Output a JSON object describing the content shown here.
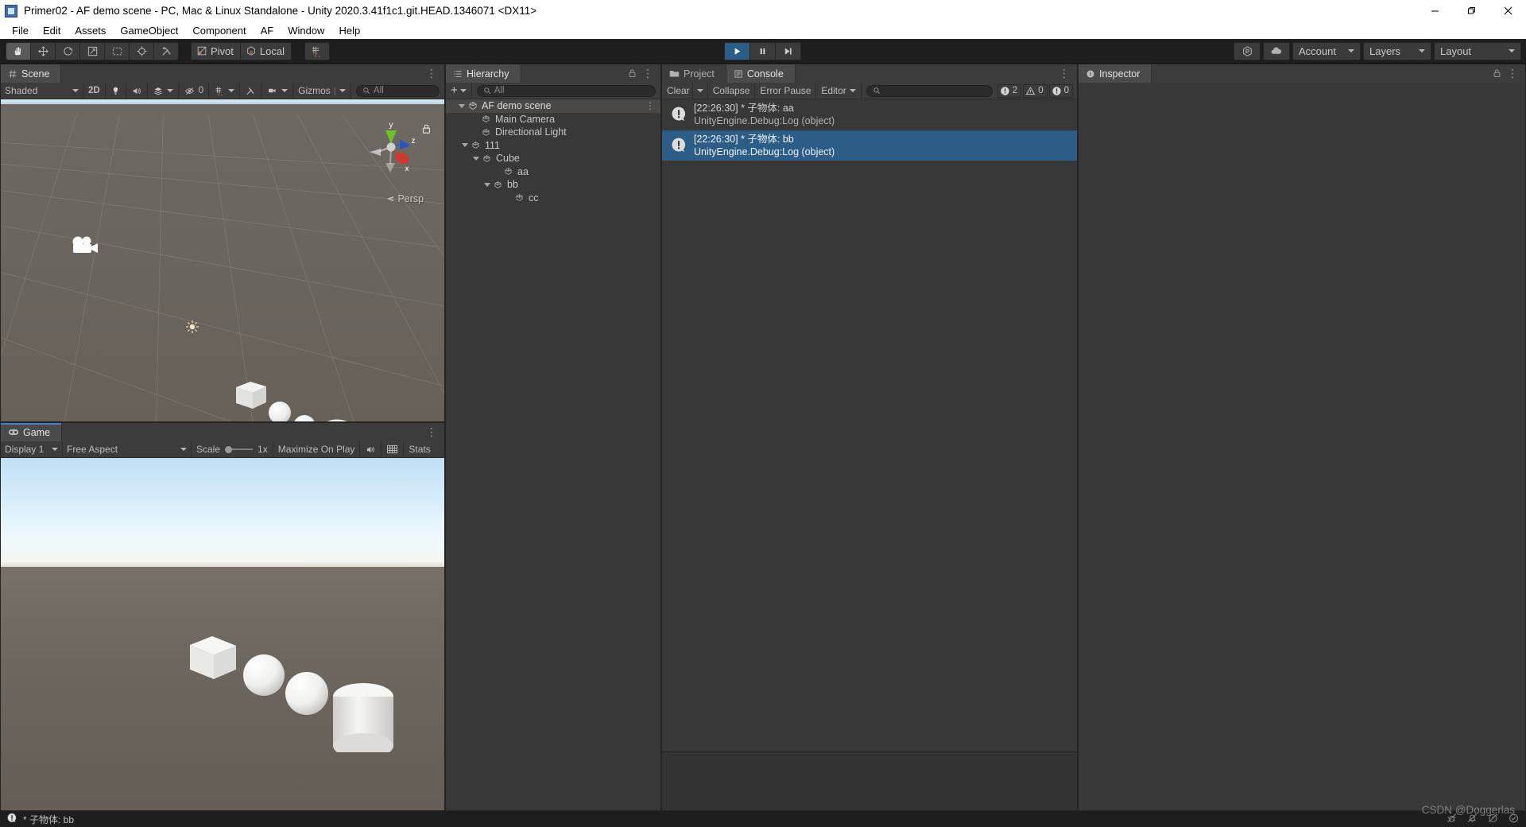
{
  "window": {
    "title": "Primer02 - AF demo scene - PC, Mac & Linux Standalone - Unity 2020.3.41f1c1.git.HEAD.1346071 <DX11>",
    "app_icon": "unity-icon",
    "minimize": "–",
    "maximize": "❐",
    "close": "✕"
  },
  "menubar": {
    "items": [
      {
        "label": "File"
      },
      {
        "label": "Edit"
      },
      {
        "label": "Assets"
      },
      {
        "label": "GameObject"
      },
      {
        "label": "Component"
      },
      {
        "label": "AF"
      },
      {
        "label": "Window"
      },
      {
        "label": "Help"
      }
    ]
  },
  "toolbar": {
    "tools": [
      {
        "name": "hand-tool",
        "active": true
      },
      {
        "name": "move-tool",
        "active": false
      },
      {
        "name": "rotate-tool",
        "active": false
      },
      {
        "name": "scale-tool",
        "active": false
      },
      {
        "name": "rect-tool",
        "active": false
      },
      {
        "name": "transform-tool",
        "active": false
      },
      {
        "name": "custom-editor-tool",
        "active": false
      }
    ],
    "pivot_label": "Pivot",
    "handle_label": "Local",
    "snap_label": "grid-snapping",
    "play": "▶",
    "pause": "‖",
    "step": "▶|",
    "play_active": true,
    "collab_label": "collab-icon",
    "cloud_label": "cloud-icon",
    "account_label": "Account",
    "layers_label": "Layers",
    "layout_label": "Layout"
  },
  "scene_panel": {
    "tab": "Scene",
    "tab_icon": "grid-icon",
    "shading": "Shaded",
    "two_d": "2D",
    "lighting_icon": "light-bulb-icon",
    "audio_icon": "audio-icon",
    "fx_icon": "effects-icon",
    "visibility_count": "0",
    "scene_vis_icon": "scene-visibility-icon",
    "grid_icon": "grid-snap-icon",
    "tool_icon": "tools-icon",
    "camera_icon": "scene-camera-icon",
    "gizmos_label": "Gizmos",
    "search_placeholder": "All",
    "perspective_label": "Persp",
    "gizmo_axes": {
      "x": "x",
      "y": "y",
      "z": "z"
    },
    "lock_icon": "lock-icon",
    "kebab_icon": "kebab-menu-icon"
  },
  "game_panel": {
    "tab": "Game",
    "tab_icon": "gamepad-icon",
    "display": "Display 1",
    "aspect": "Free Aspect",
    "scale_label": "Scale",
    "scale_value": "1x",
    "maximize_label": "Maximize On Play",
    "mute_icon": "mute-audio-icon",
    "stats_grid_icon": "gizmos-grid-icon",
    "stats_label": "Stats",
    "kebab_icon": "kebab-menu-icon"
  },
  "hierarchy_panel": {
    "tab": "Hierarchy",
    "tab_icon": "hierarchy-icon",
    "add_label": "+",
    "search_placeholder": "All",
    "lock_icon": "lock-icon",
    "kebab_icon": "kebab-menu-icon",
    "tree": [
      {
        "label": "AF demo scene",
        "depth": 0,
        "icon": "unity-scene-icon",
        "arrow": "down",
        "selected": false,
        "scene": true
      },
      {
        "label": "Main Camera",
        "depth": 1,
        "icon": "gameobject-icon",
        "arrow": "none",
        "selected": false,
        "scene": false
      },
      {
        "label": "Directional Light",
        "depth": 1,
        "icon": "gameobject-icon",
        "arrow": "none",
        "selected": false,
        "scene": false
      },
      {
        "label": "111",
        "depth": 1,
        "icon": "gameobject-icon",
        "arrow": "down",
        "selected": false,
        "scene": false
      },
      {
        "label": "Cube",
        "depth": 2,
        "icon": "gameobject-icon",
        "arrow": "down",
        "selected": false,
        "scene": false
      },
      {
        "label": "aa",
        "depth": 3,
        "icon": "gameobject-icon",
        "arrow": "none",
        "selected": false,
        "scene": false
      },
      {
        "label": "bb",
        "depth": 3,
        "icon": "gameobject-icon",
        "arrow": "down",
        "selected": false,
        "scene": false
      },
      {
        "label": "cc",
        "depth": 4,
        "icon": "gameobject-icon",
        "arrow": "none",
        "selected": false,
        "scene": false
      }
    ]
  },
  "console_panel": {
    "project_tab": "Project",
    "project_tab_icon": "folder-icon",
    "console_tab": "Console",
    "console_tab_icon": "console-icon",
    "clear_label": "Clear",
    "collapse_label": "Collapse",
    "error_pause_label": "Error Pause",
    "editor_label": "Editor",
    "search_placeholder": "",
    "kebab_icon": "kebab-menu-icon",
    "counts": {
      "log": "2",
      "warning": "0",
      "error": "0"
    },
    "messages": [
      {
        "line1": "[22:26:30] * 子物体: aa",
        "line2": "UnityEngine.Debug:Log (object)",
        "icon": "log-info-icon",
        "selected": false
      },
      {
        "line1": "[22:26:30] * 子物体: bb",
        "line2": "UnityEngine.Debug:Log (object)",
        "icon": "log-info-icon",
        "selected": true
      }
    ]
  },
  "inspector_panel": {
    "tab": "Inspector",
    "tab_icon": "info-icon",
    "lock_icon": "lock-icon",
    "kebab_icon": "kebab-menu-icon"
  },
  "statusbar": {
    "icon": "log-info-icon",
    "message": "* 子物体: bb",
    "right_icons": [
      "bug-icon",
      "notification-mute-icon",
      "error-mute-icon",
      "check-circle-icon"
    ]
  },
  "watermark": {
    "text": "CSDN @Doggerlas"
  },
  "colors": {
    "accent_blue": "#2c5d87",
    "panel_bg": "#383838",
    "tab_bg": "#3c3c3c",
    "toolbar_bg": "#1e1e1e",
    "scene_ground": "#6b6560"
  }
}
